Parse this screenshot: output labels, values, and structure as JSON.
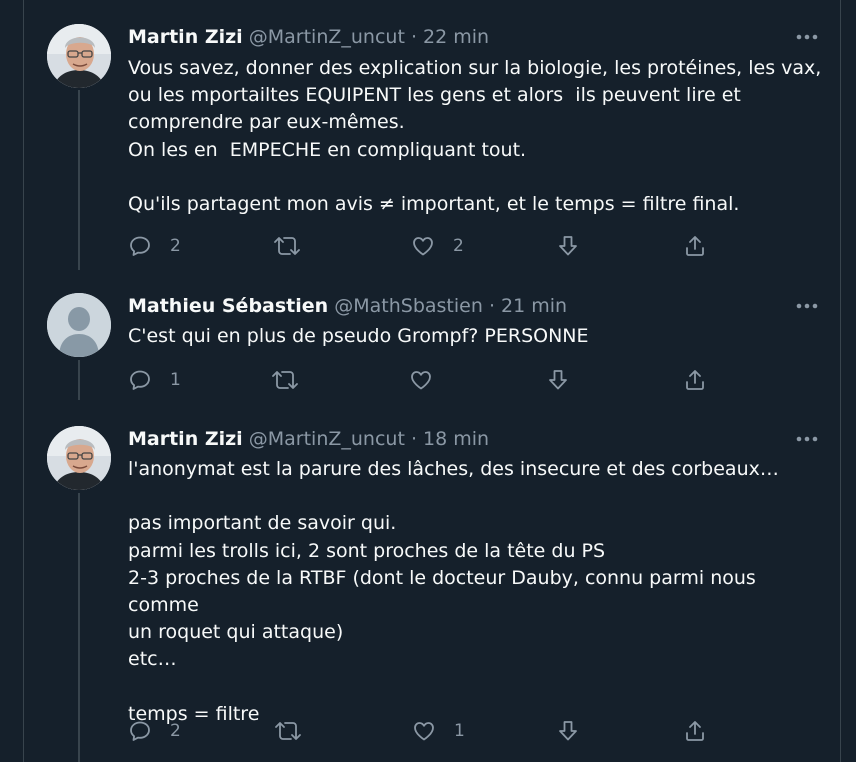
{
  "tweets": [
    {
      "author": "Martin Zizi",
      "handle": "@MartinZ_uncut",
      "separator": "·",
      "time": "22 min",
      "text": "Vous savez, donner des explication sur la biologie, les protéines, les vax,\nou les mportailtes EQUIPENT les gens et alors  ils peuvent lire et\ncomprendre par eux-mêmes.\nOn les en  EMPECHE en compliquant tout.\n\nQu'ils partagent mon avis ≠ important, et le temps = filtre final.",
      "replies": "2",
      "retweets": "",
      "likes": "2",
      "avatar": "photo-avatar"
    },
    {
      "author": "Mathieu Sébastien",
      "handle": "@MathSbastien",
      "separator": "·",
      "time": "21 min",
      "text": "C'est qui en plus de pseudo Grompf? PERSONNE",
      "replies": "1",
      "retweets": "",
      "likes": "",
      "avatar": "default-avatar"
    },
    {
      "author": "Martin Zizi",
      "handle": "@MartinZ_uncut",
      "separator": "·",
      "time": "18 min",
      "text": "l'anonymat est la parure des lâches, des insecure et des corbeaux…\n\npas important de savoir qui.\nparmi les trolls ici, 2 sont proches de la tête du PS\n2-3 proches de la RTBF (dont le docteur Dauby, connu parmi nous comme\nun roquet qui attaque)\netc…\n\ntemps = filtre",
      "replies": "2",
      "retweets": "",
      "likes": "1",
      "avatar": "photo-avatar"
    }
  ],
  "icons": {
    "reply": "reply-icon",
    "retweet": "retweet-icon",
    "like": "heart-icon",
    "downvote": "downvote-arrow-icon",
    "share": "share-icon",
    "more": "more-dots-icon"
  },
  "colors": {
    "background": "#15202b",
    "text": "#f7f9f9",
    "secondary": "#8b98a5",
    "border": "#38444d"
  }
}
